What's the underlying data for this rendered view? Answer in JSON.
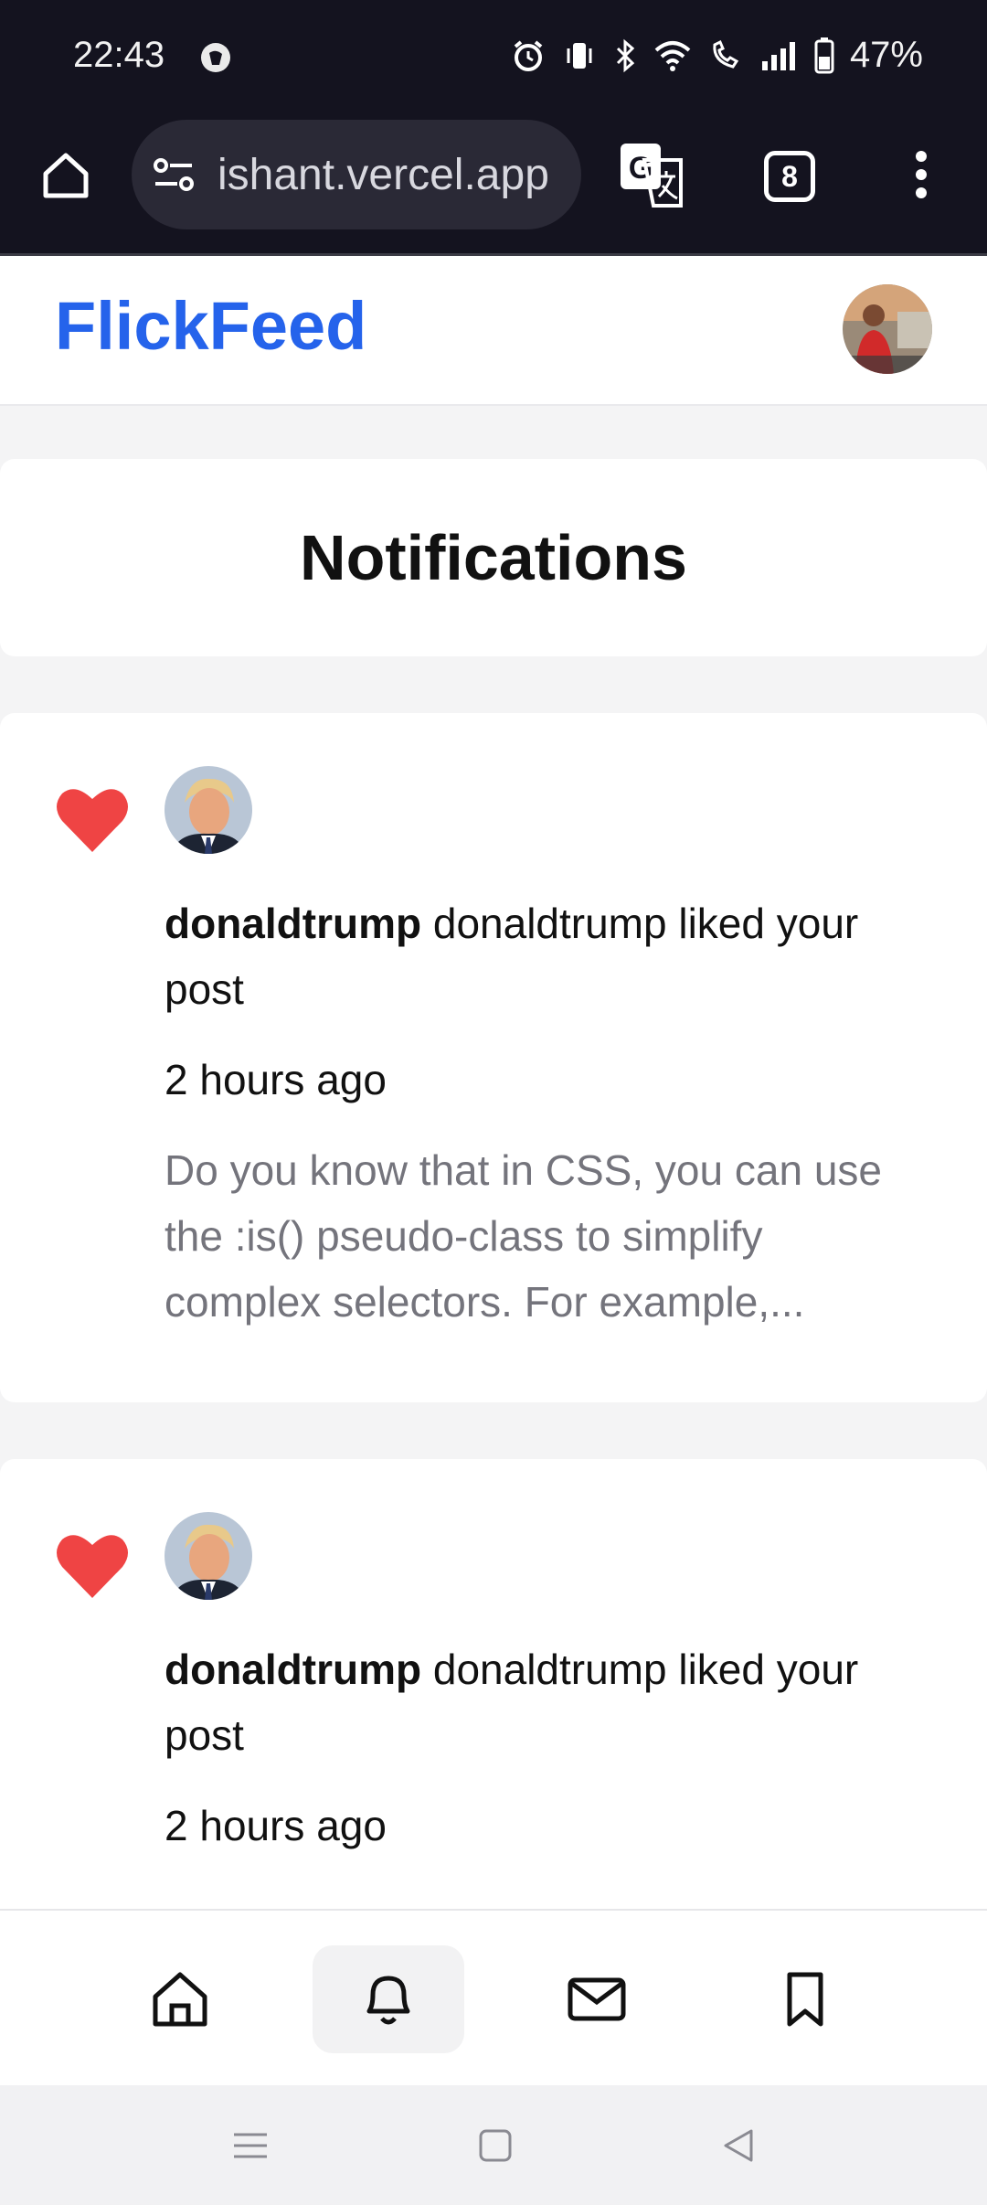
{
  "status_bar": {
    "time": "22:43",
    "battery_percent": "47%",
    "icons": [
      "app-notification-icon",
      "alarm-icon",
      "vibrate-icon",
      "bluetooth-icon",
      "wifi-icon",
      "wifi-calling-icon",
      "signal-icon",
      "battery-icon"
    ]
  },
  "browser": {
    "url": "ishant.vercel.app",
    "tab_count": "8"
  },
  "app": {
    "brand": "FlickFeed",
    "brand_color": "#2563eb"
  },
  "page": {
    "title": "Notifications"
  },
  "notifications": [
    {
      "icon": "heart-icon",
      "username": "donaldtrump",
      "message": "donaldtrump liked your post",
      "time": "2 hours ago",
      "preview": "Do you know that in CSS, you can use the :is() pseudo-class to simplify complex selectors. For example,..."
    },
    {
      "icon": "heart-icon",
      "username": "donaldtrump",
      "message": "donaldtrump liked your post",
      "time": "2 hours ago"
    }
  ],
  "bottom_nav": {
    "items": [
      "home-icon",
      "bell-icon",
      "mail-icon",
      "bookmark-icon"
    ],
    "active": "bell-icon"
  },
  "colors": {
    "heart": "#ef4444",
    "accent": "#2563eb"
  }
}
